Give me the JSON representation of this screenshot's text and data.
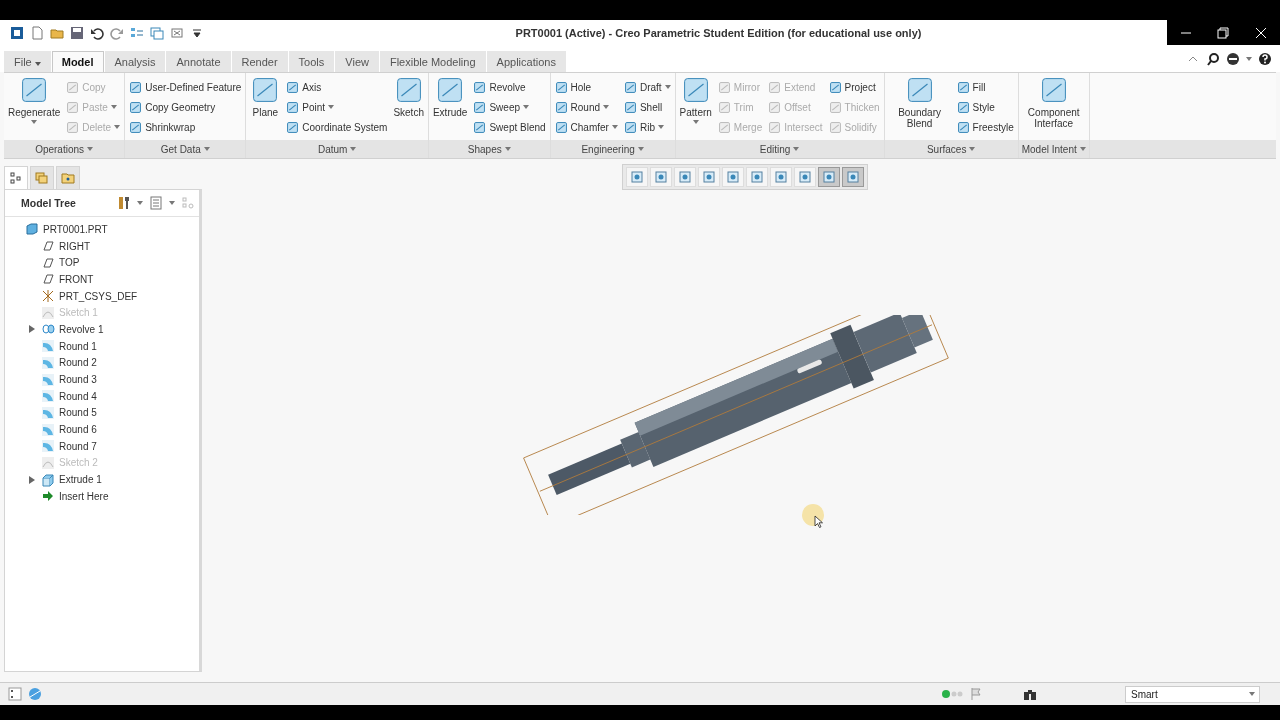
{
  "window": {
    "title": "PRT0001 (Active) - Creo Parametric Student Edition (for educational use only)"
  },
  "tabs": [
    {
      "label": "File",
      "selected": false,
      "dropdown": true
    },
    {
      "label": "Model",
      "selected": true,
      "dropdown": false
    },
    {
      "label": "Analysis",
      "selected": false,
      "dropdown": false
    },
    {
      "label": "Annotate",
      "selected": false,
      "dropdown": false
    },
    {
      "label": "Render",
      "selected": false,
      "dropdown": false
    },
    {
      "label": "Tools",
      "selected": false,
      "dropdown": false
    },
    {
      "label": "View",
      "selected": false,
      "dropdown": false
    },
    {
      "label": "Flexible Modeling",
      "selected": false,
      "dropdown": false
    },
    {
      "label": "Applications",
      "selected": false,
      "dropdown": false
    }
  ],
  "ribbon": [
    {
      "label": "Operations",
      "columns": [
        [
          {
            "label": "Regenerate",
            "kind": "large",
            "disabled": false,
            "dropdown": true
          }
        ],
        [
          {
            "label": "Copy",
            "kind": "small",
            "disabled": true,
            "dropdown": false
          },
          {
            "label": "Paste",
            "kind": "small",
            "disabled": true,
            "dropdown": true
          },
          {
            "label": "Delete",
            "kind": "small",
            "disabled": true,
            "dropdown": true
          }
        ]
      ]
    },
    {
      "label": "Get Data",
      "columns": [
        [
          {
            "label": "User-Defined Feature",
            "kind": "small",
            "disabled": false,
            "dropdown": false
          },
          {
            "label": "Copy Geometry",
            "kind": "small",
            "disabled": false,
            "dropdown": false
          },
          {
            "label": "Shrinkwrap",
            "kind": "small",
            "disabled": false,
            "dropdown": false
          }
        ]
      ]
    },
    {
      "label": "Datum",
      "columns": [
        [
          {
            "label": "Plane",
            "kind": "large",
            "disabled": false,
            "dropdown": false
          }
        ],
        [
          {
            "label": "Axis",
            "kind": "small",
            "disabled": false,
            "dropdown": false
          },
          {
            "label": "Point",
            "kind": "small",
            "disabled": false,
            "dropdown": true
          },
          {
            "label": "Coordinate System",
            "kind": "small",
            "disabled": false,
            "dropdown": false
          }
        ],
        [
          {
            "label": "Sketch",
            "kind": "large",
            "disabled": false,
            "dropdown": false
          }
        ]
      ]
    },
    {
      "label": "Shapes",
      "columns": [
        [
          {
            "label": "Extrude",
            "kind": "large",
            "disabled": false,
            "dropdown": false
          }
        ],
        [
          {
            "label": "Revolve",
            "kind": "small",
            "disabled": false,
            "dropdown": false
          },
          {
            "label": "Sweep",
            "kind": "small",
            "disabled": false,
            "dropdown": true
          },
          {
            "label": "Swept Blend",
            "kind": "small",
            "disabled": false,
            "dropdown": false
          }
        ]
      ]
    },
    {
      "label": "Engineering",
      "columns": [
        [
          {
            "label": "Hole",
            "kind": "small",
            "disabled": false,
            "dropdown": false
          },
          {
            "label": "Round",
            "kind": "small",
            "disabled": false,
            "dropdown": true
          },
          {
            "label": "Chamfer",
            "kind": "small",
            "disabled": false,
            "dropdown": true
          }
        ],
        [
          {
            "label": "Draft",
            "kind": "small",
            "disabled": false,
            "dropdown": true
          },
          {
            "label": "Shell",
            "kind": "small",
            "disabled": false,
            "dropdown": false
          },
          {
            "label": "Rib",
            "kind": "small",
            "disabled": false,
            "dropdown": true
          }
        ]
      ]
    },
    {
      "label": "Editing",
      "columns": [
        [
          {
            "label": "Pattern",
            "kind": "large",
            "disabled": false,
            "dropdown": true
          }
        ],
        [
          {
            "label": "Mirror",
            "kind": "small",
            "disabled": true,
            "dropdown": false
          },
          {
            "label": "Trim",
            "kind": "small",
            "disabled": true,
            "dropdown": false
          },
          {
            "label": "Merge",
            "kind": "small",
            "disabled": true,
            "dropdown": false
          }
        ],
        [
          {
            "label": "Extend",
            "kind": "small",
            "disabled": true,
            "dropdown": false
          },
          {
            "label": "Offset",
            "kind": "small",
            "disabled": true,
            "dropdown": false
          },
          {
            "label": "Intersect",
            "kind": "small",
            "disabled": true,
            "dropdown": false
          }
        ],
        [
          {
            "label": "Project",
            "kind": "small",
            "disabled": false,
            "dropdown": false
          },
          {
            "label": "Thicken",
            "kind": "small",
            "disabled": true,
            "dropdown": false
          },
          {
            "label": "Solidify",
            "kind": "small",
            "disabled": true,
            "dropdown": false
          }
        ]
      ]
    },
    {
      "label": "Surfaces",
      "columns": [
        [
          {
            "label": "Boundary Blend",
            "kind": "large",
            "disabled": false,
            "dropdown": false
          }
        ],
        [
          {
            "label": "Fill",
            "kind": "small",
            "disabled": false,
            "dropdown": false
          },
          {
            "label": "Style",
            "kind": "small",
            "disabled": false,
            "dropdown": false
          },
          {
            "label": "Freestyle",
            "kind": "small",
            "disabled": false,
            "dropdown": false
          }
        ]
      ]
    },
    {
      "label": "Model Intent",
      "columns": [
        [
          {
            "label": "Component Interface",
            "kind": "large",
            "disabled": false,
            "dropdown": false
          }
        ]
      ]
    }
  ],
  "view_toolbar": [
    {
      "selected": false
    },
    {
      "selected": false
    },
    {
      "selected": false
    },
    {
      "selected": false
    },
    {
      "selected": false
    },
    {
      "selected": false
    },
    {
      "selected": false
    },
    {
      "selected": false
    },
    {
      "selected": true
    },
    {
      "selected": true
    }
  ],
  "panel_tabs": [
    {
      "selected": true
    },
    {
      "selected": false
    },
    {
      "selected": false
    }
  ],
  "model_tree": {
    "title": "Model Tree",
    "items": [
      {
        "label": "PRT0001.PRT",
        "kind": "part",
        "disabled": false,
        "children": [
          {
            "label": "RIGHT",
            "kind": "plane",
            "disabled": false
          },
          {
            "label": "TOP",
            "kind": "plane",
            "disabled": false
          },
          {
            "label": "FRONT",
            "kind": "plane",
            "disabled": false
          },
          {
            "label": "PRT_CSYS_DEF",
            "kind": "csys",
            "disabled": false
          },
          {
            "label": "Sketch 1",
            "kind": "sketch",
            "disabled": true
          },
          {
            "label": "Revolve 1",
            "kind": "revolve",
            "disabled": false,
            "expanded": false
          },
          {
            "label": "Round 1",
            "kind": "round",
            "disabled": false
          },
          {
            "label": "Round 2",
            "kind": "round",
            "disabled": false
          },
          {
            "label": "Round 3",
            "kind": "round",
            "disabled": false
          },
          {
            "label": "Round 4",
            "kind": "round",
            "disabled": false
          },
          {
            "label": "Round 5",
            "kind": "round",
            "disabled": false
          },
          {
            "label": "Round 6",
            "kind": "round",
            "disabled": false
          },
          {
            "label": "Round 7",
            "kind": "round",
            "disabled": false
          },
          {
            "label": "Sketch 2",
            "kind": "sketch",
            "disabled": true
          },
          {
            "label": "Extrude 1",
            "kind": "extrude",
            "disabled": false,
            "expanded": false
          },
          {
            "label": "Insert Here",
            "kind": "insert",
            "disabled": false
          }
        ]
      }
    ]
  },
  "status_bar": {
    "filter": "Smart"
  }
}
